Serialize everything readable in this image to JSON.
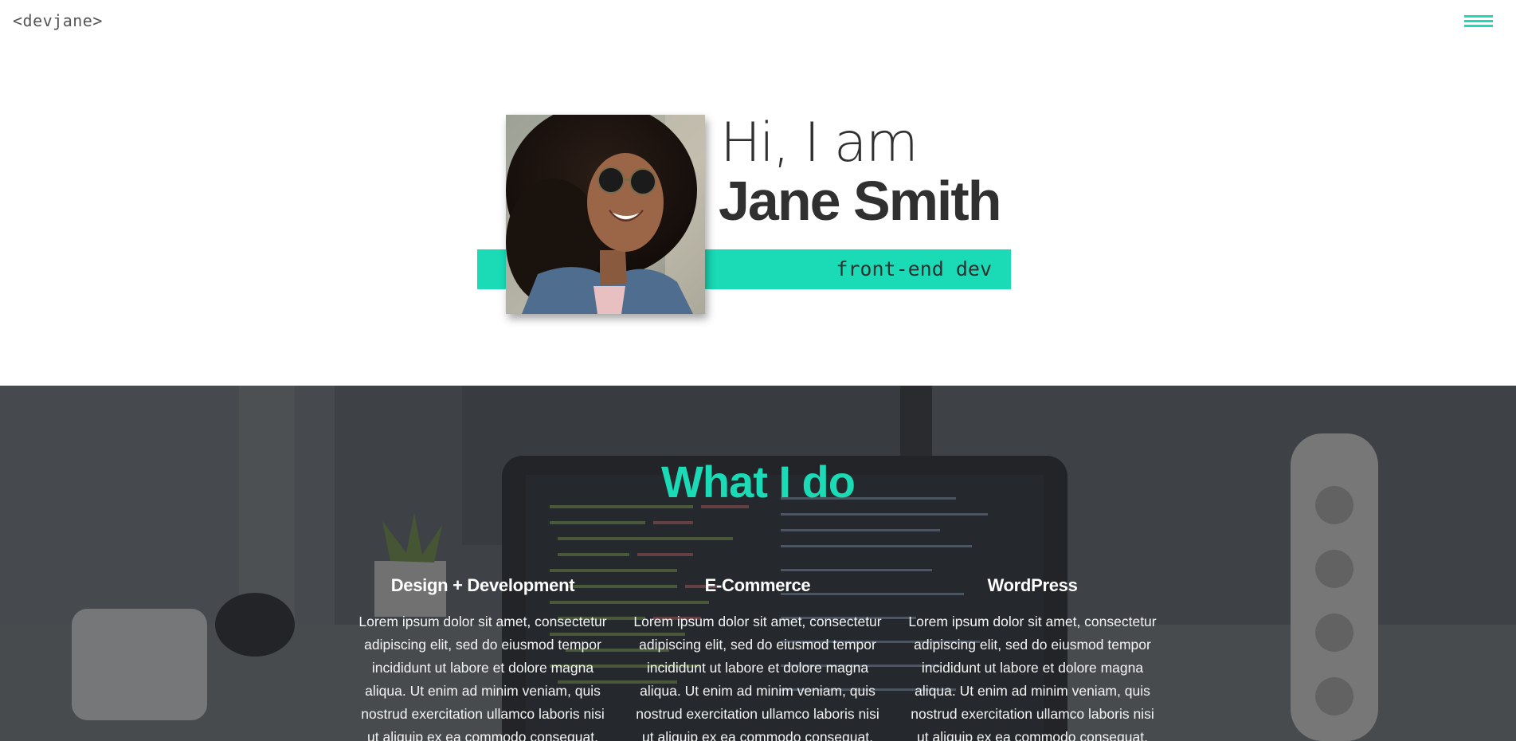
{
  "header": {
    "logo": "<devjane>",
    "menu_icon": "hamburger-menu-icon"
  },
  "hero": {
    "greeting": "Hi, I am",
    "name": "Jane Smith",
    "role": "front-end dev",
    "photo_alt": "Portrait of Jane Smith wearing sunglasses and a denim jacket"
  },
  "services": {
    "title": "What I do",
    "items": [
      {
        "title": "Design + Development",
        "text": "Lorem ipsum dolor sit amet, consectetur adipiscing elit, sed do eiusmod tempor incididunt ut labore et dolore magna aliqua. Ut enim ad minim veniam, quis nostrud exercitation ullamco laboris nisi ut aliquip ex ea commodo consequat."
      },
      {
        "title": "E-Commerce",
        "text": "Lorem ipsum dolor sit amet, consectetur adipiscing elit, sed do eiusmod tempor incididunt ut labore et dolore magna aliqua. Ut enim ad minim veniam, quis nostrud exercitation ullamco laboris nisi ut aliquip ex ea commodo consequat."
      },
      {
        "title": "WordPress",
        "text": "Lorem ipsum dolor sit amet, consectetur adipiscing elit, sed do eiusmod tempor incididunt ut labore et dolore magna aliqua. Ut enim ad minim veniam, quis nostrud exercitation ullamco laboris nisi ut aliquip ex ea commodo consequat."
      }
    ]
  },
  "colors": {
    "accent": "#1adbb6",
    "text_dark": "#303030",
    "section_bg": "#3b3f44"
  }
}
